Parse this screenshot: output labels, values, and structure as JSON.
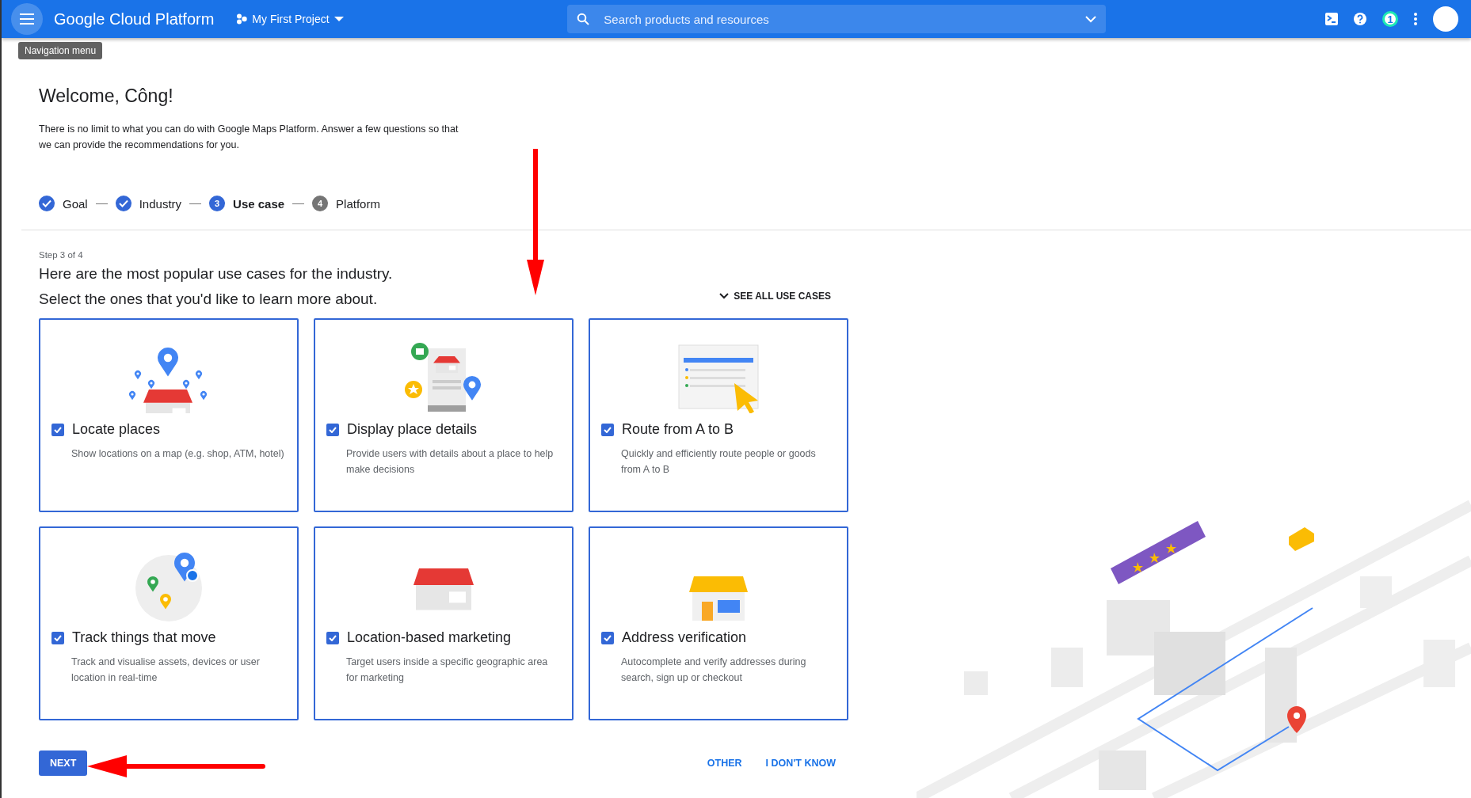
{
  "header": {
    "title": "Google Cloud Platform",
    "project": "My First Project",
    "search": {
      "placeholder": "Search products and resources"
    },
    "notifications": "1"
  },
  "tooltip": "Navigation menu",
  "welcome": {
    "title": "Welcome, Công!",
    "description": "There is no limit to what you can do with Google Maps Platform. Answer a few questions so that we can provide the recommendations for you."
  },
  "steps": [
    {
      "label": "Goal",
      "completed": true,
      "selected": false
    },
    {
      "label": "Industry",
      "completed": true,
      "selected": false
    },
    {
      "label": "Use case",
      "number": "3",
      "completed": false,
      "selected": true
    },
    {
      "label": "Platform",
      "number": "4",
      "completed": false,
      "selected": false
    }
  ],
  "step_label": "Step 3 of 4",
  "heading": [
    "Here are the most popular use cases for the industry.",
    "Select the ones that you'd like to learn more about."
  ],
  "see_all": "SEE ALL USE CASES",
  "use_cases": [
    {
      "kind": "locate",
      "title": "Locate places",
      "description": "Show locations on a map (e.g. shop, ATM, hotel)",
      "checked": true
    },
    {
      "kind": "details",
      "title": "Display place details",
      "description": "Provide users with details about a place to help make decisions",
      "checked": true
    },
    {
      "kind": "route",
      "title": "Route from A to B",
      "description": "Quickly and efficiently route people or goods from A to B",
      "checked": true
    },
    {
      "kind": "track",
      "title": "Track things that move",
      "description": "Track and visualise assets, devices or user location in real-time",
      "checked": true
    },
    {
      "kind": "marketing",
      "title": "Location-based marketing",
      "description": "Target users inside a specific geographic area for marketing",
      "checked": true
    },
    {
      "kind": "address",
      "title": "Address verification",
      "description": "Autocomplete and verify addresses during search, sign up or checkout",
      "checked": true
    }
  ],
  "buttons": {
    "next": "NEXT",
    "other": "OTHER",
    "dont_know": "I DON'T KNOW"
  }
}
